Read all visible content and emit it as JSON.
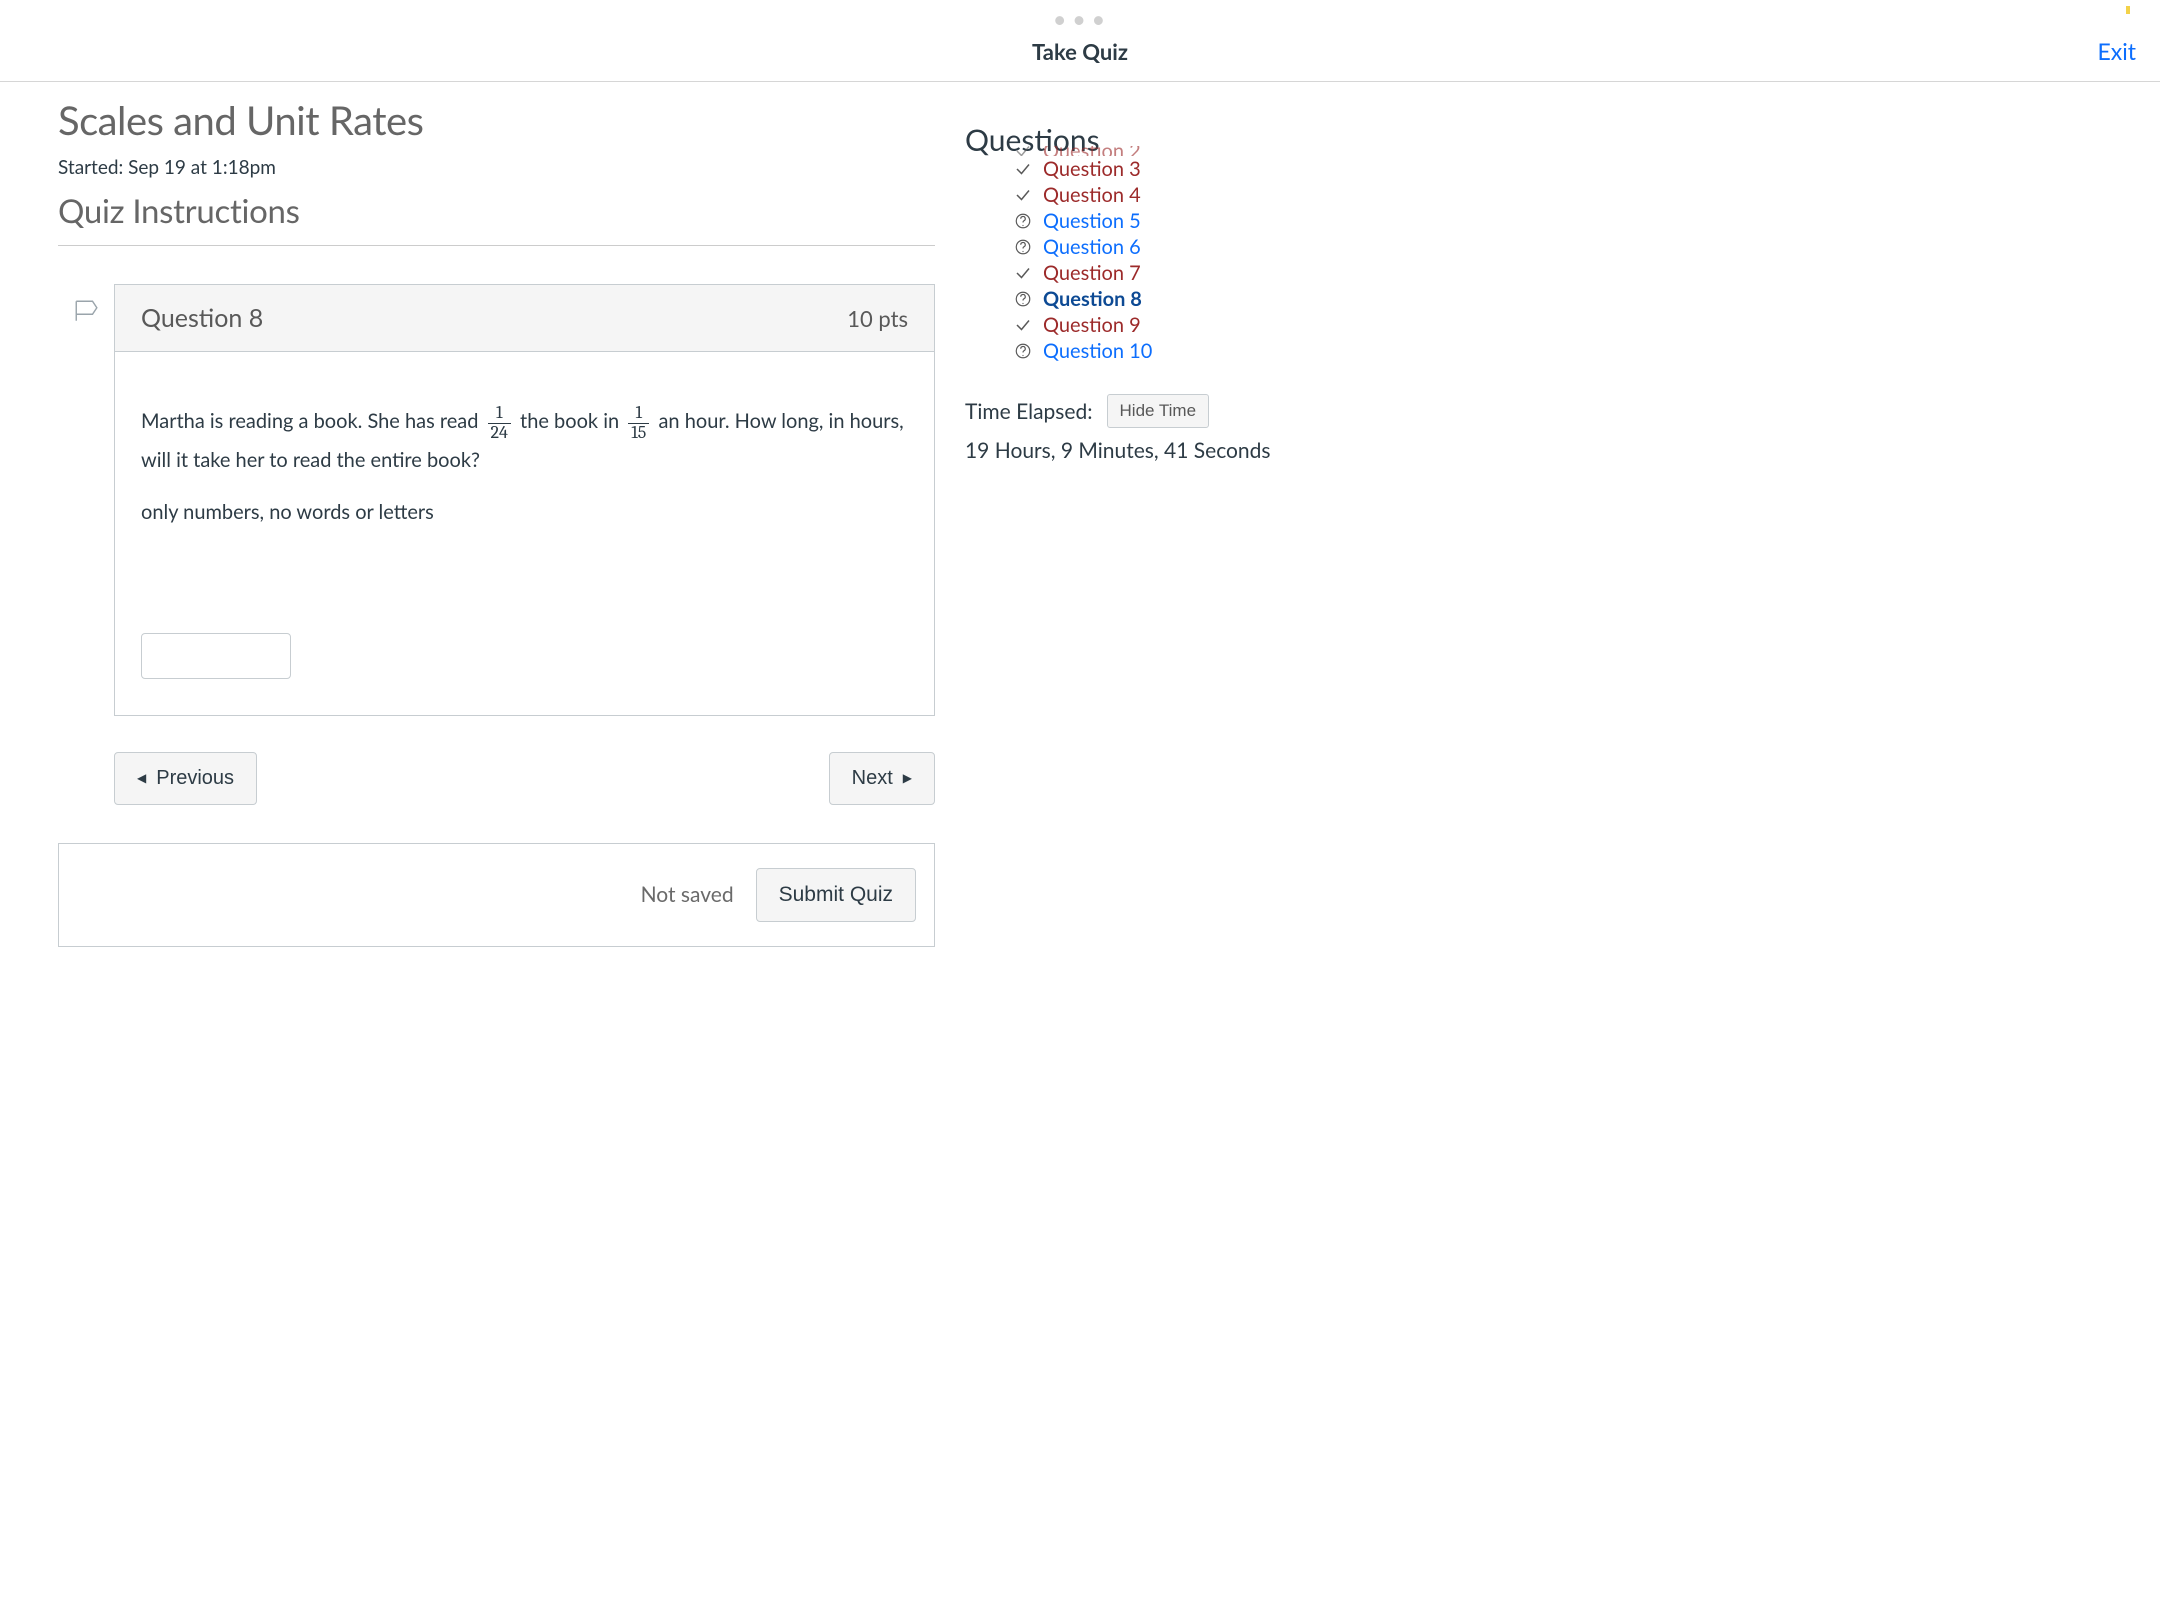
{
  "top": {
    "title": "Take Quiz",
    "exit": "Exit"
  },
  "quiz": {
    "title": "Scales and Unit Rates",
    "started": "Started: Sep 19 at 1:18pm",
    "instructions_heading": "Quiz Instructions"
  },
  "question": {
    "label": "Question 8",
    "points": "10 pts",
    "text_a": "Martha is reading a book.  She has read ",
    "frac1_num": "1",
    "frac1_den": "24",
    "text_b": " the book in ",
    "frac2_num": "1",
    "frac2_den": "15",
    "text_c": " an hour.  How long, in hours, will it take her to read the entire book?",
    "hint": "only numbers, no words or letters",
    "answer": ""
  },
  "nav": {
    "prev": "Previous",
    "next": "Next"
  },
  "submit": {
    "status": "Not saved",
    "button": "Submit Quiz"
  },
  "sidebar": {
    "title": "Questions",
    "items": [
      {
        "label": "Question 2",
        "status": "done"
      },
      {
        "label": "Question 3",
        "status": "done"
      },
      {
        "label": "Question 4",
        "status": "done"
      },
      {
        "label": "Question 5",
        "status": "pending"
      },
      {
        "label": "Question 6",
        "status": "pending"
      },
      {
        "label": "Question 7",
        "status": "done"
      },
      {
        "label": "Question 8",
        "status": "current"
      },
      {
        "label": "Question 9",
        "status": "done"
      },
      {
        "label": "Question 10",
        "status": "pending"
      }
    ],
    "timer_label": "Time Elapsed:",
    "hide_time": "Hide Time",
    "elapsed": "19 Hours, 9 Minutes, 41 Seconds"
  }
}
